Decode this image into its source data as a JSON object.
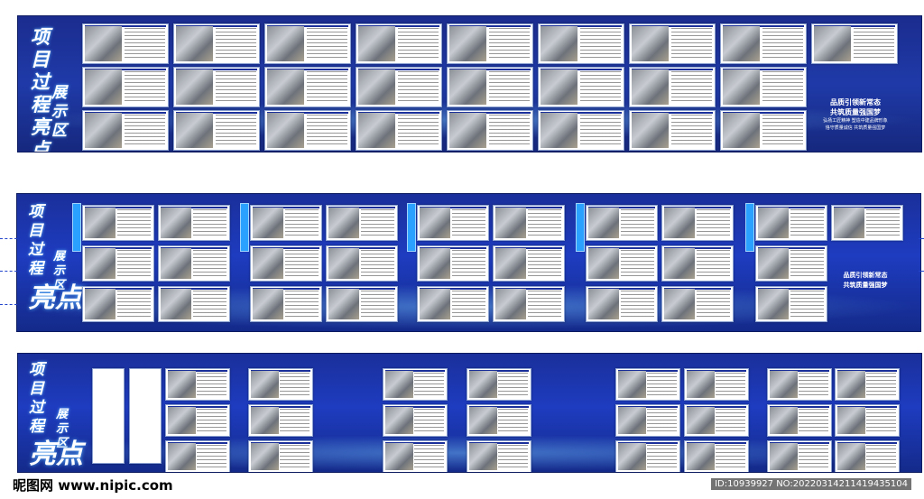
{
  "board_title_line1": "项目过程",
  "board_title_line2": "亮点",
  "board_title_sub": "展示区",
  "slogan_line1": "品质引领新常态",
  "slogan_line2": "共筑质量强国梦",
  "slogan_small1": "弘扬工匠精神  塑造中建品牌形象",
  "slogan_small2": "恪守质量诚信  共筑质量强国梦",
  "watermark_left": "昵图网 www.nipic.com",
  "watermark_right": "ID:10939927 NO:20220314211419435104",
  "colors": {
    "board": "#1e3cc0",
    "accent": "#2aa0ff"
  }
}
